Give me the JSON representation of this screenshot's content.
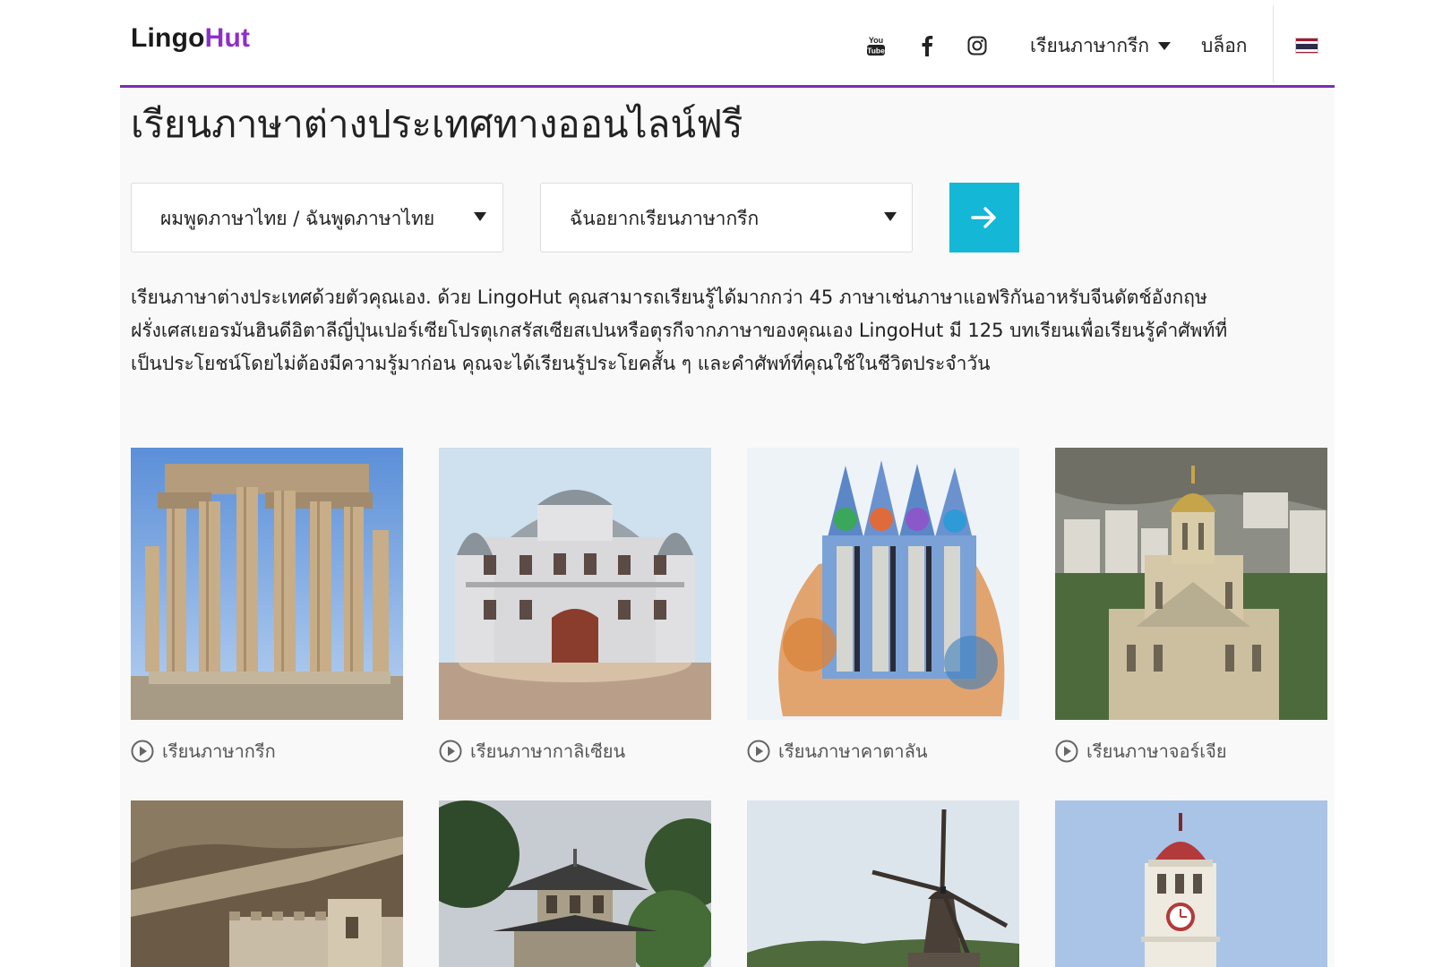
{
  "header": {
    "logo_part1": "Lingo",
    "logo_part2": "Hut",
    "nav": {
      "youtube_icon": "youtube-icon",
      "facebook_icon": "facebook-icon",
      "instagram_icon": "instagram-icon",
      "language_menu_label": "เรียนภาษากรีก",
      "blog_label": "บล็อก",
      "flag": "thailand-flag"
    }
  },
  "main": {
    "title": "เรียนภาษาต่างประเทศทางออนไลน์ฟรี",
    "native_select": "ผมพูดภาษาไทย / ฉันพูดภาษาไทย",
    "target_select": "ฉันอยากเรียนภาษากรีก",
    "description_lines": [
      "เรียนภาษาต่างประเทศด้วยตัวคุณเอง. ด้วย LingoHut คุณสามารถเรียนรู้ได้มากกว่า 45 ภาษาเช่นภาษาแอฟริกันอาหรับจีนดัตช์อังกฤษ",
      "ฝรั่งเศสเยอรมันฮินดีอิตาลีญี่ปุ่นเปอร์เซียโปรตุเกสรัสเซียสเปนหรือตุรกีจากภาษาของคุณเอง LingoHut มี 125 บทเรียนเพื่อเรียนรู้คำศัพท์ที่",
      "เป็นประโยชน์โดยไม่ต้องมีความรู้มาก่อน คุณจะได้เรียนรู้ประโยคสั้น ๆ และคำศัพท์ที่คุณใช้ในชีวิตประจำวัน"
    ],
    "courses": [
      {
        "label": "เรียนภาษากรีก"
      },
      {
        "label": "เรียนภาษากาลิเซียน"
      },
      {
        "label": "เรียนภาษาคาตาลัน"
      },
      {
        "label": "เรียนภาษาจอร์เจีย"
      },
      {
        "label": ""
      },
      {
        "label": ""
      },
      {
        "label": ""
      },
      {
        "label": ""
      }
    ]
  },
  "colors": {
    "accent_purple": "#7b2fb0",
    "logo_hut": "#8e2fc9",
    "go_button": "#14b7d6"
  }
}
